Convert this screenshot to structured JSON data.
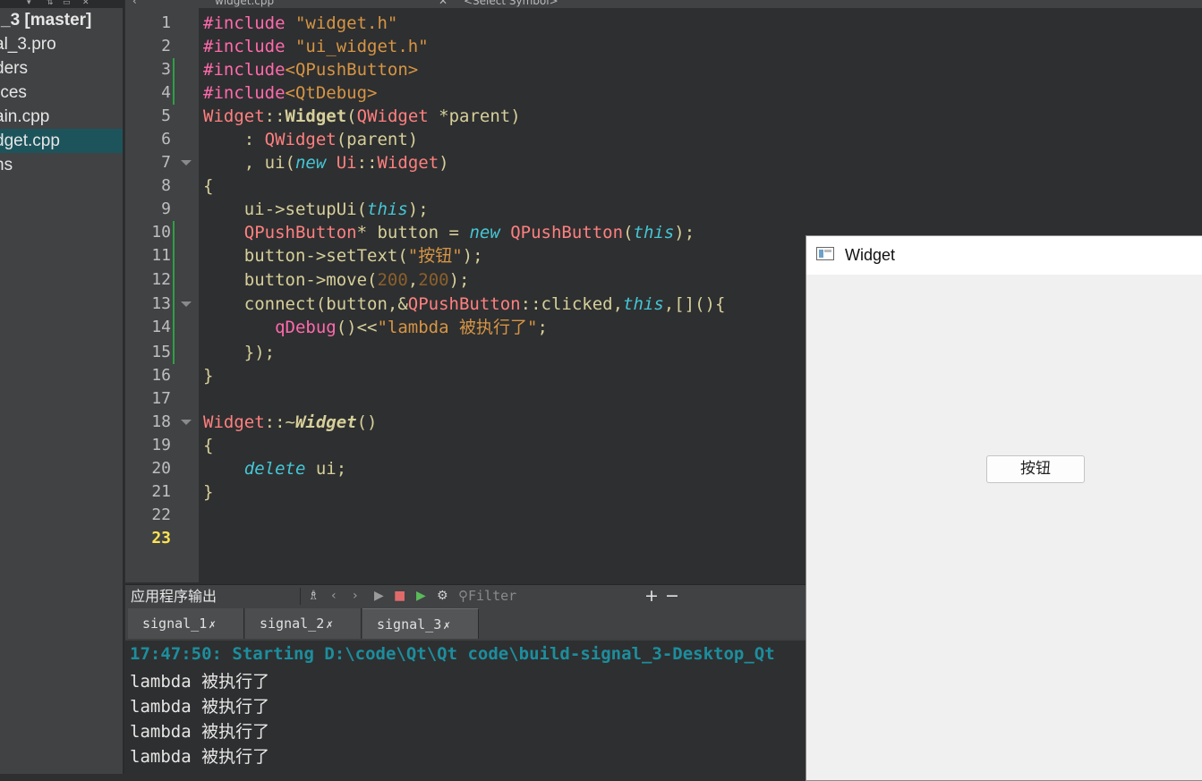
{
  "tree": {
    "items": [
      "_3 [master]",
      "al_3.pro",
      "ders",
      "rces",
      "ain.cpp",
      "dget.cpp",
      "ns"
    ],
    "selected_index": 5
  },
  "editor_bar": {
    "file": "widget.cpp",
    "symbol": "<Select Symbol>"
  },
  "editor": {
    "current_line": 23,
    "lines": [
      "#include \"widget.h\"",
      "#include \"ui_widget.h\"",
      "#include<QPushButton>",
      "#include<QtDebug>",
      "Widget::Widget(QWidget *parent)",
      "    : QWidget(parent)",
      "    , ui(new Ui::Widget)",
      "{",
      "    ui->setupUi(this);",
      "    QPushButton* button = new QPushButton(this);",
      "    button->setText(\"按钮\");",
      "    button->move(200,200);",
      "    connect(button,&QPushButton::clicked,this,[](){",
      "       qDebug()<<\"lambda 被执行了\";",
      "    });",
      "}",
      "",
      "Widget::~Widget()",
      "{",
      "    delete ui;",
      "}",
      "",
      ""
    ]
  },
  "output": {
    "title": "应用程序输出",
    "filter_placeholder": "Filter",
    "tabs": [
      "signal_1",
      "signal_2",
      "signal_3"
    ],
    "active_tab": 2,
    "start_line": "17:47:50: Starting D:\\code\\Qt\\Qt code\\build-signal_3-Desktop_Qt",
    "lines": [
      "lambda 被执行了",
      "lambda 被执行了",
      "lambda 被执行了",
      "lambda 被执行了"
    ]
  },
  "app_window": {
    "title": "Widget",
    "button_label": "按钮"
  }
}
